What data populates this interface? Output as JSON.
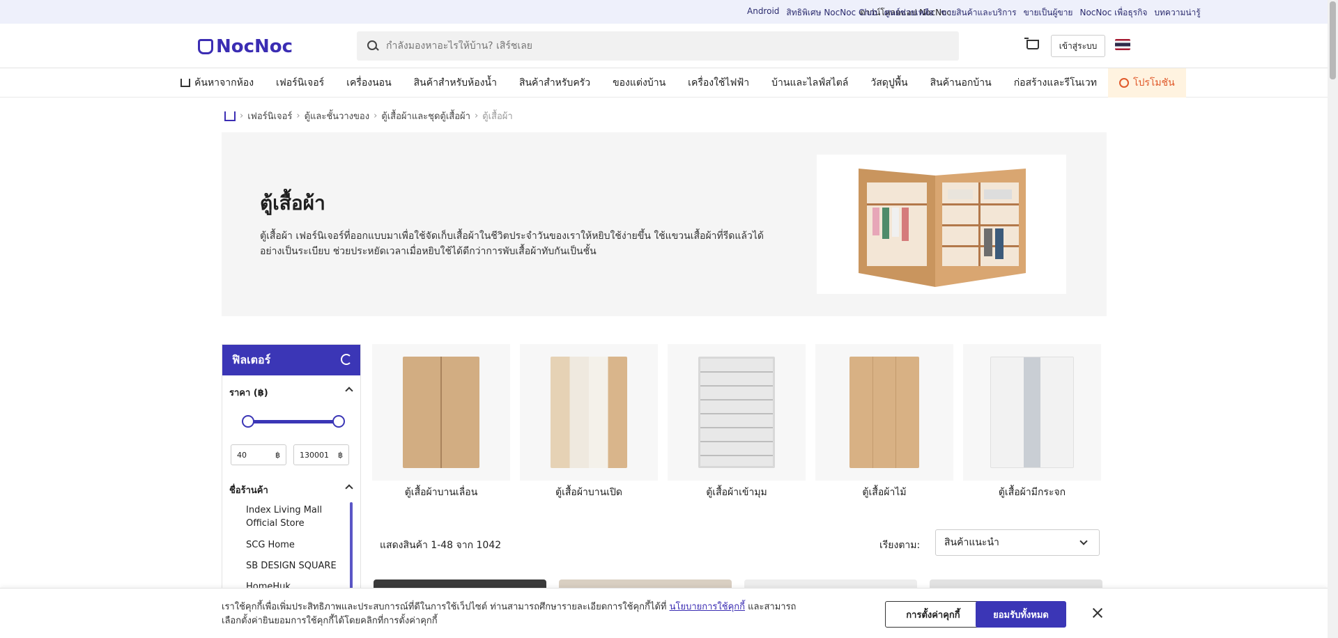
{
  "topbar": {
    "download": "ดาวน์โหลดแอป NocNoc",
    "links": [
      "Android",
      "สิทธิพิเศษ NocNoc Club",
      "ศูนย์ช่วยเหลือ",
      "ขายสินค้าและบริการ",
      "ขายเป็นผู้ขาย",
      "NocNoc เพื่อธุรกิจ",
      "บทความน่ารู้"
    ]
  },
  "header": {
    "logo": "NocNoc",
    "search_placeholder": "กำลังมองหาอะไรให้บ้าน? เสิร์ชเลย",
    "login": "เข้าสู่ระบบ"
  },
  "nav": {
    "items": [
      "ค้นหาจากห้อง",
      "เฟอร์นิเจอร์",
      "เครื่องนอน",
      "สินค้าสำหรับห้องน้ำ",
      "สินค้าสำหรับครัว",
      "ของแต่งบ้าน",
      "เครื่องใช้ไฟฟ้า",
      "บ้านและไลฟ์สไตล์",
      "วัสดุปูพื้น",
      "สินค้านอกบ้าน",
      "ก่อสร้างและรีโนเวท"
    ],
    "promo": "โปรโมชัน"
  },
  "breadcrumb": [
    "เฟอร์นิเจอร์",
    "ตู้และชั้นวางของ",
    "ตู้เสื้อผ้าและชุดตู้เสื้อผ้า",
    "ตู้เสื้อผ้า"
  ],
  "hero": {
    "title": "ตู้เสื้อผ้า",
    "description": "ตู้เสื้อผ้า เฟอร์นิเจอร์ที่ออกแบบมาเพื่อใช้จัดเก็บเสื้อผ้าในชีวิตประจำวันของเราให้หยิบใช้ง่ายขึ้น ใช้แขวนเสื้อผ้าที่รีดแล้วได้อย่างเป็นระเบียบ ช่วยประหยัดเวลาเมื่อหยิบใช้ได้ดีกว่าการพับเสื้อผ้าทับกันเป็นชั้น"
  },
  "filter": {
    "title": "ฟิลเตอร์",
    "price_label": "ราคา (฿)",
    "min_price": "40",
    "max_price": "130001",
    "currency": "฿",
    "shop_label": "ชื่อร้านค้า",
    "shops": [
      "Index Living Mall Official Store",
      "SCG Home",
      "SB DESIGN SQUARE",
      "HomeHuk"
    ]
  },
  "categories": [
    "ตู้เสื้อผ้าบานเลื่อน",
    "ตู้เสื้อผ้าบานเปิด",
    "ตู้เสื้อผ้าเข้ามุม",
    "ตู้เสื้อผ้าไม้",
    "ตู้เสื้อผ้ามีกระจก"
  ],
  "results": {
    "count": "แสดงสินค้า 1-48 จาก 1042",
    "sort_label": "เรียงตาม:",
    "sort_value": "สินค้าแนะนำ"
  },
  "cookie": {
    "text_before": "เราใช้คุกกี้เพื่อเพิ่มประสิทธิภาพและประสบการณ์ที่ดีในการใช้เว็ปไซต์ ท่านสามารถศึกษารายละเอียดการใช้คุกกี้ได้ที่ ",
    "link": "นโยบายการใช้คุกกี้",
    "text_after": " และสามารถเลือกตั้งค่ายินยอมการใช้คุกกี้ได้โดยคลิกที่การตั้งค่าคุกกี้",
    "settings": "การตั้งค่าคุกกี้",
    "accept": "ยอมรับทั้งหมด"
  },
  "colors": {
    "brand": "#3b36b6",
    "promo": "#e0592a",
    "hero_bg": "#f5f5f5"
  }
}
